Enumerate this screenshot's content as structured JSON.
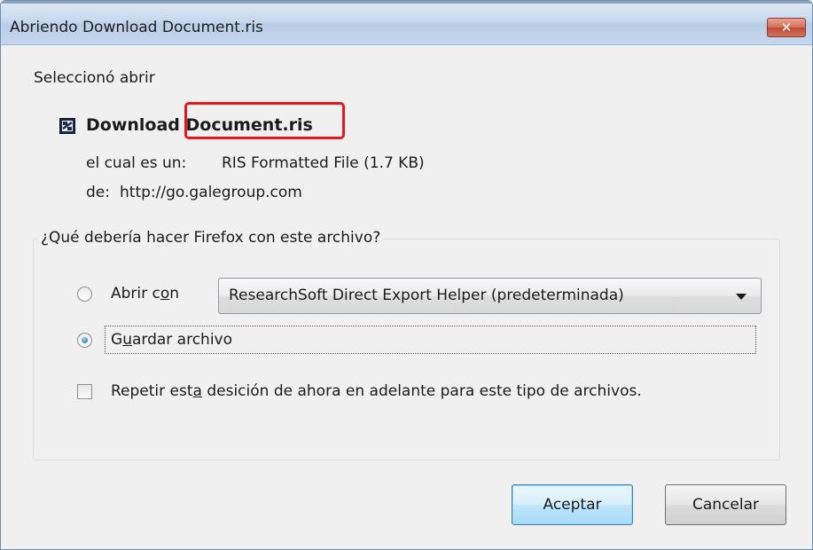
{
  "window": {
    "title": "Abriendo Download Document.ris",
    "close_symbol": "✕",
    "close_icon": "close-icon"
  },
  "intro": {
    "selected_open_label": "Seleccionó abrir"
  },
  "file": {
    "icon": "document-icon",
    "name": "Download Document.ris",
    "type_label": "el cual es un:",
    "type_value": "RIS Formatted File (1.7  KB)",
    "from_label": "de:",
    "from_value": "http://go.galegroup.com",
    "highlight_color": "#e8161e"
  },
  "action_group": {
    "legend": "¿Qué debería hacer Firefox con este archivo?",
    "open_with": {
      "label_before": "Abrir c",
      "label_access": "o",
      "label_after": "n",
      "selected": false,
      "app_select_value": "ResearchSoft Direct Export Helper (predeterminada)"
    },
    "save_file": {
      "label_before": "G",
      "label_access": "u",
      "label_after": "ardar archivo",
      "selected": true
    },
    "remember": {
      "label_before": "Repetir est",
      "label_access": "a",
      "label_after": " desición de ahora en adelante para este tipo de archivos.",
      "checked": false
    }
  },
  "buttons": {
    "accept_label": "Aceptar",
    "cancel_label": "Cancelar"
  }
}
